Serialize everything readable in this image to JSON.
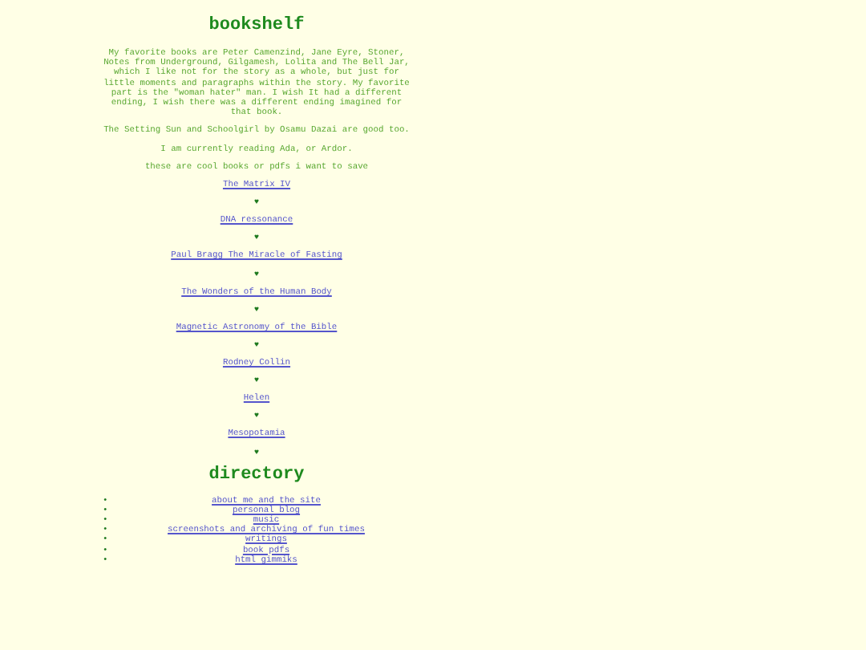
{
  "title": "bookshelf",
  "paragraphs": [
    "My favorite books are Peter Camenzind, Jane Eyre, Stoner, Notes from Underground, Gilgamesh, Lolita and The Bell Jar, which I like not for the story as a whole, but just for little moments and paragraphs within the story. My favorite part is the \"woman hater\" man. I wish It had a different ending, I wish there was a different ending imagined for that book.",
    "The Setting Sun and Schoolgirl by Osamu Dazai are good too.",
    "I am currently reading Ada, or Ardor.",
    "these are cool books or pdfs i want to save"
  ],
  "saved_links": [
    {
      "label": "The Matrix IV",
      "separator": "♥"
    },
    {
      "label": "DNA ressonance",
      "separator": "♥"
    },
    {
      "label": "Paul Bragg The Miracle of Fasting",
      "separator": "♥"
    },
    {
      "label": "The Wonders of the Human Body",
      "separator": "♥"
    },
    {
      "label": "Magnetic Astronomy of the Bible",
      "separator": "♥"
    },
    {
      "label": "Rodney Collin",
      "separator": "♥"
    },
    {
      "label": "Helen",
      "separator": "♥"
    },
    {
      "label": "Mesopotamia",
      "separator": "♥"
    }
  ],
  "directory": {
    "title": "directory",
    "items": [
      {
        "label": "about me and the site",
        "bullet": "•"
      },
      {
        "label": "personal blog",
        "bullet": "•"
      },
      {
        "label": "music",
        "bullet": "•"
      },
      {
        "label": "screenshots and archiving of fun times",
        "bullet": "•"
      },
      {
        "label": "writings",
        "bullet": "•"
      },
      {
        "label": "book pdfs",
        "bullet": "•"
      },
      {
        "label": "html gimmiks",
        "bullet": "•"
      }
    ]
  }
}
